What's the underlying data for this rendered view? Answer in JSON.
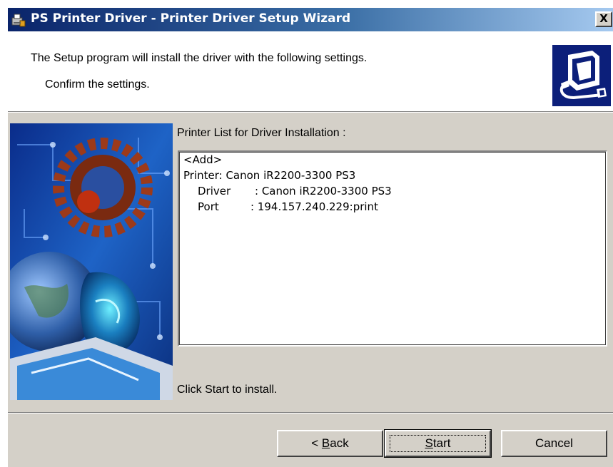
{
  "window": {
    "title": "PS Printer Driver - Printer Driver Setup Wizard",
    "close_label": "X"
  },
  "header": {
    "line1": "The Setup program will install the driver with the following settings.",
    "line2": "Confirm the settings.",
    "icon": "computer-setup-icon"
  },
  "list": {
    "label": "Printer List for Driver Installation :",
    "lines": {
      "add": "<Add>",
      "printer": "Printer: Canon iR2200-3300 PS3",
      "driver_key": "Driver",
      "driver_value": ": Canon iR2200-3300 PS3",
      "port_key": "Port",
      "port_value": ": 194.157.240.229:print"
    }
  },
  "footer": {
    "instruction": "Click Start to install."
  },
  "buttons": {
    "back": {
      "prefix": "< ",
      "mnemonic": "B",
      "rest": "ack"
    },
    "start": {
      "mnemonic": "S",
      "rest": "tart"
    },
    "cancel": "Cancel"
  },
  "colors": {
    "title_bar_start": "#0a246a",
    "title_bar_end": "#a6caf0",
    "dialog_face": "#d4d0c8",
    "header_icon_bg": "#0c1f7a"
  }
}
